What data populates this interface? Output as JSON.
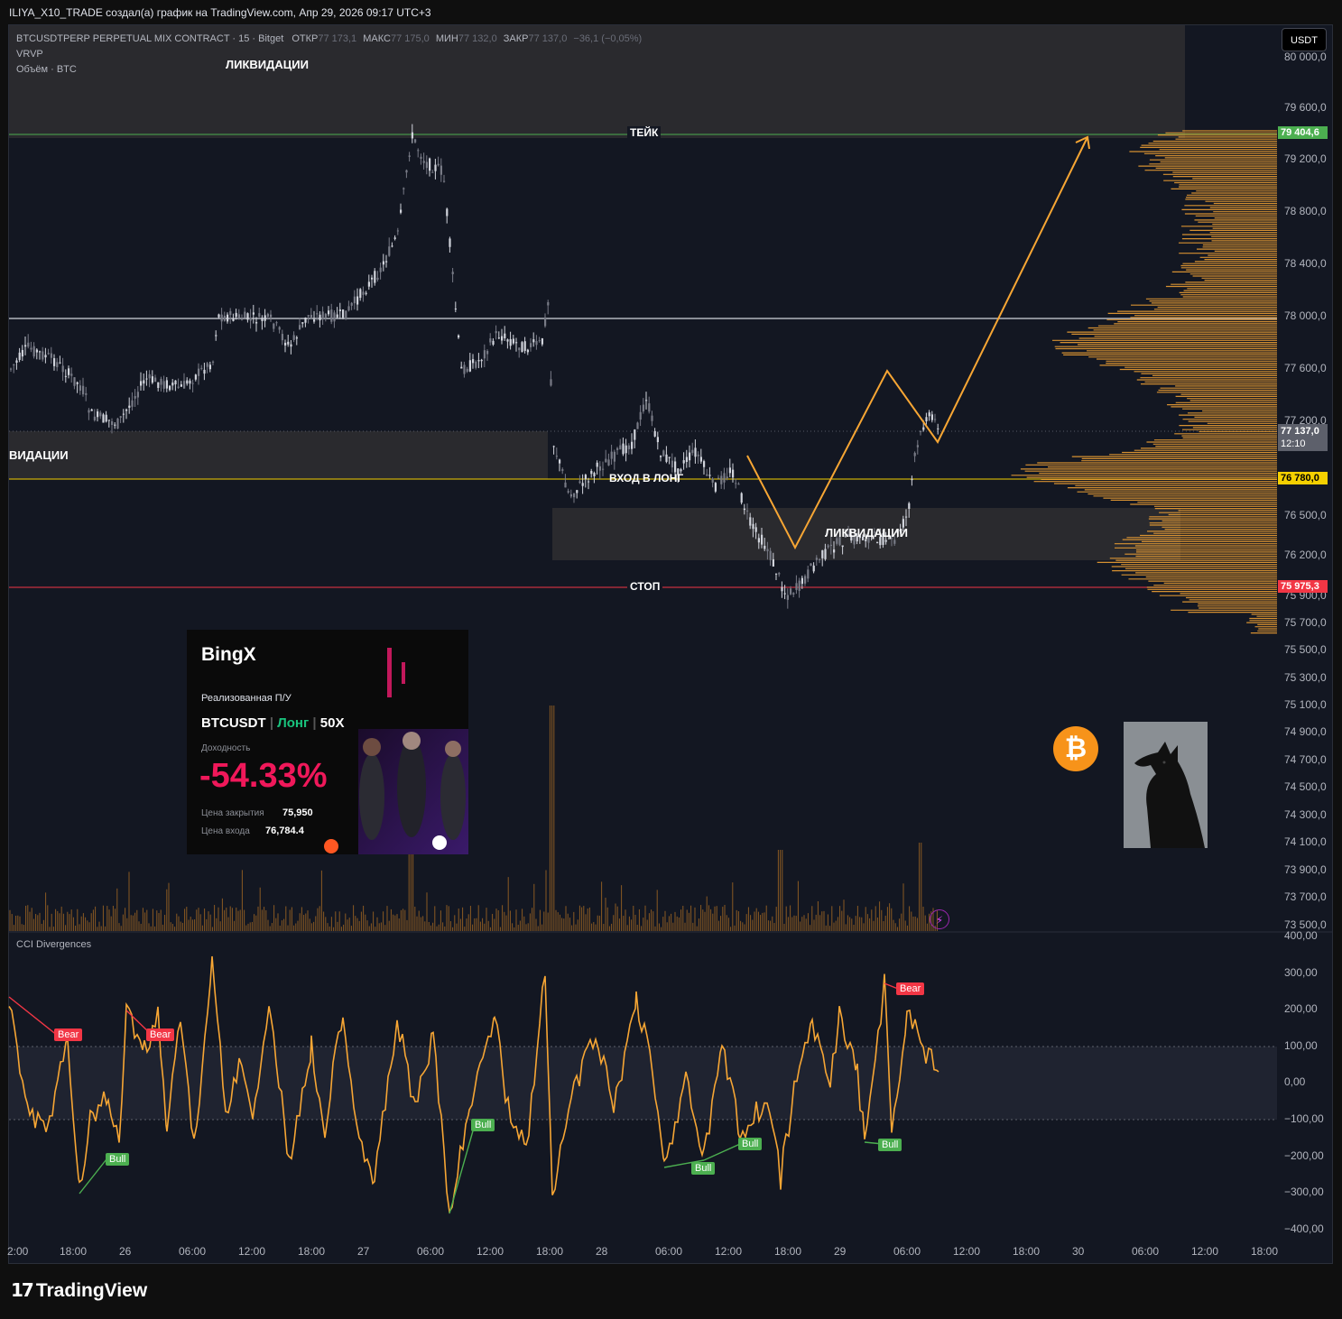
{
  "header": {
    "text": "ILIYA_X10_TRADE создал(а) график на TradingView.com, Апр 29, 2026 09:17 UTC+3"
  },
  "legend": {
    "symbol": "BTCUSDTPERP PERPETUAL MIX CONTRACT · 15 · Bitget",
    "open_label": "ОТКР",
    "open_value": "77 173,1",
    "high_label": "МАКС",
    "high_value": "77 175,0",
    "low_label": "МИН",
    "low_value": "77 132,0",
    "close_label": "ЗАКР",
    "close_value": "77 137,0",
    "change": "−36,1 (−0,05%)",
    "indicator1": "VRVP",
    "indicator2": "Объём · BTC"
  },
  "currency_button": "USDT",
  "zones": {
    "top_liquidation": "ЛИКВИДАЦИИ",
    "mid_liquidation": "ВИДАЦИИ",
    "low_liquidation": "ЛИКВИДАЦИИ"
  },
  "lines": {
    "take": "ТЕЙК",
    "entry": "ВХОД В ЛОНГ",
    "stop": "СТОП"
  },
  "price_tags": {
    "take": "79 404,6",
    "current": "77 137,0",
    "countdown": "12:10",
    "entry": "76 780,0",
    "stop": "75 975,3"
  },
  "colors": {
    "take": "#4caf50",
    "entry": "#f5d000",
    "stop": "#f23645",
    "current": "#363a45",
    "projection": "#f7a634",
    "cci": "#f7a634"
  },
  "price_axis": [
    "80 000,0",
    "79 600,0",
    "79 200,0",
    "78 800,0",
    "78 400,0",
    "78 000,0",
    "77 600,0",
    "77 200,0",
    "76 500,0",
    "76 200,0",
    "75 900,0",
    "75 700,0",
    "75 500,0",
    "75 300,0",
    "75 100,0",
    "74 900,0",
    "74 700,0",
    "74 500,0",
    "74 300,0",
    "74 100,0",
    "73 900,0",
    "73 700,0",
    "73 500,0"
  ],
  "cci": {
    "title": "CCI Divergences",
    "axis": [
      "400,00",
      "300,00",
      "200,00",
      "100,00",
      "0,00",
      "−100,00",
      "−200,00",
      "−300,00",
      "−400,00"
    ],
    "signals": [
      "Bear",
      "Bear",
      "Bull",
      "Bull",
      "Bull",
      "Bull",
      "Bull",
      "Bear"
    ]
  },
  "time_axis": [
    "2:00",
    "18:00",
    "26",
    "06:00",
    "12:00",
    "18:00",
    "27",
    "06:00",
    "12:00",
    "18:00",
    "28",
    "06:00",
    "12:00",
    "18:00",
    "29",
    "06:00",
    "12:00",
    "18:00",
    "30",
    "06:00",
    "12:00",
    "18:00"
  ],
  "bingx": {
    "logo": "BingX",
    "pnl_title": "Реализованная П/У",
    "pair": "BTCUSDT",
    "side": "Лонг",
    "leverage": "50X",
    "yield_label": "Доходность",
    "yield": "-54.33%",
    "close_label": "Цена закрытия",
    "close_value": "75,950",
    "entry_label": "Цена входа",
    "entry_value": "76,784.4"
  },
  "footer": {
    "brand": "TradingView"
  },
  "icons": [
    "bitcoin-icon",
    "lightning-icon",
    "tradingview-logo-icon"
  ]
}
